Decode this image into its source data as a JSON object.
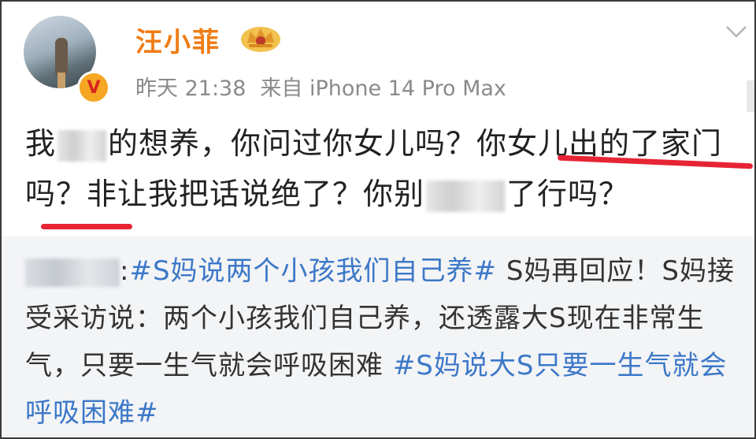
{
  "post": {
    "username": "汪小菲",
    "verified_badge": "V",
    "time": "昨天 21:38",
    "source": "来自 iPhone 14 Pro Max",
    "text_parts": {
      "p1": "我",
      "p2": "的想养，你问过你女儿吗？",
      "p3": "你女儿出的了",
      "p4": "家门",
      "p5": "吗？非让我把话说绝了？你别",
      "p6": "了行吗？"
    }
  },
  "repost": {
    "colon": ":",
    "topic1": "#S妈说两个小孩我们自己养#",
    "text1": " S妈再回应！S妈接受采访说：两个小孩我们自己养，还透露大S现在非常生气，只要一生气就会呼吸困难 ",
    "topic2": "#S妈说大S只要一生气就会呼吸困难#"
  },
  "colors": {
    "username": "#f07c15",
    "topic": "#3c78c8",
    "underline": "#e62434",
    "repost_bg": "#f3f4f6"
  },
  "icons": [
    "avatar",
    "verified-badge-icon",
    "crown-badge-icon",
    "chevron-down-icon"
  ]
}
